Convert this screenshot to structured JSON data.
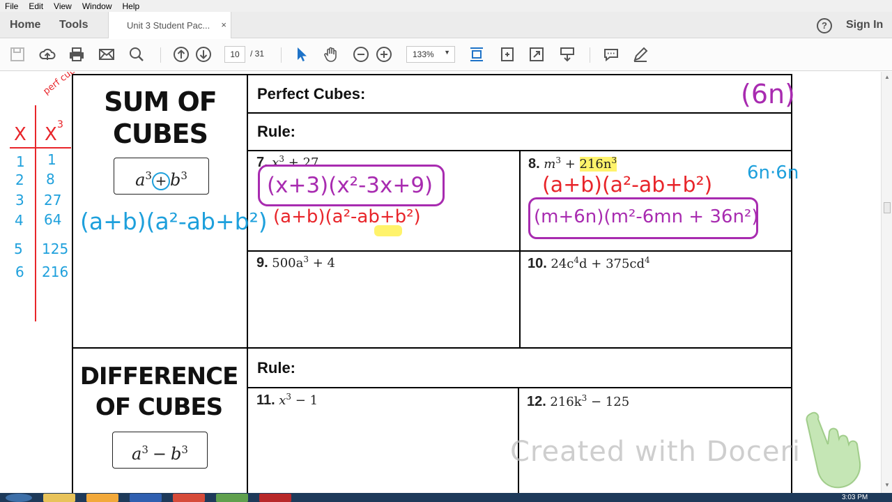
{
  "menu": [
    "File",
    "Edit",
    "View",
    "Window",
    "Help"
  ],
  "nav": {
    "home": "Home",
    "tools": "Tools",
    "doc_tab": "Unit 3 Student Pac...",
    "close": "×",
    "help": "?",
    "signin": "Sign In"
  },
  "toolbar": {
    "page_current": "10",
    "page_total": "/ 31",
    "zoom": "133%",
    "zoom_arrow": "▼"
  },
  "colors": {
    "accent_blue": "#1e73c8",
    "ink_red": "#e8252a",
    "ink_blue": "#1ea0dc",
    "ink_purple": "#a82bb0",
    "highlight": "#ffef3a"
  },
  "table_annotation": {
    "perfect_cube_note": "perf cube",
    "col_x": "X",
    "col_x3": "X",
    "col_x3_exp": "3",
    "rows": [
      {
        "x": "1",
        "x3": "1"
      },
      {
        "x": "2",
        "x3": "8"
      },
      {
        "x": "3",
        "x3": "27"
      },
      {
        "x": "4",
        "x3": "64"
      },
      {
        "x": "5",
        "x3": "125"
      },
      {
        "x": "6",
        "x3": "216"
      }
    ]
  },
  "sum_section": {
    "title_line1": "SUM OF",
    "title_line2": "CUBES",
    "formula_a": "a",
    "formula_op": "+",
    "formula_b": "b",
    "exp": "3",
    "handwritten_formula": "(a+b)(a²-ab+b²)",
    "perfect_cubes_label": "Perfect Cubes:",
    "perfect_cubes_note": "(6n)",
    "rule_label": "Rule:"
  },
  "problems": {
    "p7": {
      "num": "7.",
      "expr_base": "x",
      "expr_exp": "3",
      "expr_rest": " + 27",
      "ans_factored": "(x+3)(x²-3x+9)",
      "ans_template": "(a+b)(a²-ab+b²)"
    },
    "p8": {
      "num": "8.",
      "expr_base": "m",
      "expr_exp": "3",
      "expr_plus": " + ",
      "expr_term": "216n",
      "expr_term_exp": "3",
      "note": "6n·6n",
      "ans_template": "(a+b)(a²-ab+b²)",
      "ans_factored": "(m+6n)(m²-6mn + 36n²)"
    },
    "p9": {
      "num": "9.",
      "expr": "500a",
      "exp": "3",
      "rest": " + 4"
    },
    "p10": {
      "num": "10.",
      "expr1": "24c",
      "exp1": "4",
      "expr2": "d + 375cd",
      "exp2": "4"
    },
    "p11": {
      "num": "11.",
      "expr_base": "x",
      "exp": "3",
      "rest": " − 1"
    },
    "p12": {
      "num": "12.",
      "expr": "216k",
      "exp": "3",
      "rest": " − 125"
    }
  },
  "diff_section": {
    "title_line1": "DIFFERENCE",
    "title_line2": "OF CUBES",
    "formula_a": "a",
    "formula_op": "−",
    "formula_b": "b",
    "exp": "3",
    "rule_label": "Rule:"
  },
  "watermark": "Created with Doceri",
  "clock": "3:03 PM"
}
